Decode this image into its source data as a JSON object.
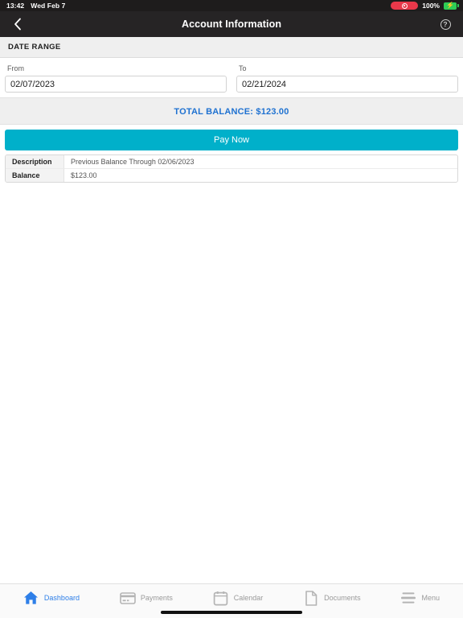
{
  "statusbar": {
    "time": "13:42",
    "date": "Wed Feb 7",
    "battery_percent": "100%",
    "recording_indicator": "record-icon",
    "battery_icon": "battery-charging-icon",
    "bolt_glyph": "⚡"
  },
  "navbar": {
    "back_icon": "chevron-left-icon",
    "title": "Account Information",
    "help_icon": "help-circle-icon",
    "help_glyph": "?"
  },
  "section": {
    "date_range_header": "DATE RANGE"
  },
  "date_range": {
    "from_label": "From",
    "from_value": "02/07/2023",
    "from_placeholder": "MM/DD/YYYY",
    "to_label": "To",
    "to_value": "02/21/2024",
    "to_placeholder": "MM/DD/YYYY"
  },
  "total_balance": {
    "text": "TOTAL BALANCE: $123.00",
    "label": "TOTAL BALANCE:",
    "amount": "$123.00",
    "color": "#1f72d1"
  },
  "actions": {
    "pay_now_label": "Pay Now",
    "pay_now_color": "#00b0ca"
  },
  "detail_table": {
    "rows": [
      {
        "label": "Description",
        "value": "Previous Balance Through 02/06/2023"
      },
      {
        "label": "Balance",
        "value": "$123.00"
      }
    ]
  },
  "tabbar": {
    "items": [
      {
        "label": "Dashboard",
        "icon": "home-icon",
        "active": true
      },
      {
        "label": "Payments",
        "icon": "credit-card-icon",
        "active": false
      },
      {
        "label": "Calendar",
        "icon": "calendar-icon",
        "active": false
      },
      {
        "label": "Documents",
        "icon": "document-icon",
        "active": false
      },
      {
        "label": "Menu",
        "icon": "hamburger-menu-icon",
        "active": false
      }
    ],
    "active_color": "#2e7fe8",
    "inactive_color": "#9a9a9a"
  }
}
